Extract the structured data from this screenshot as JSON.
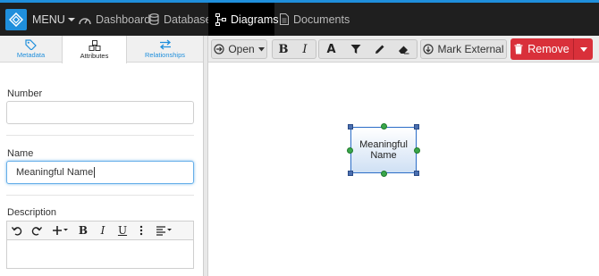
{
  "nav": {
    "menu_label": "MENU",
    "items": [
      {
        "label": "Dashboard",
        "icon": "dashboard-icon"
      },
      {
        "label": "Database",
        "icon": "database-icon"
      },
      {
        "label": "Diagrams",
        "icon": "diagram-icon",
        "active": true
      },
      {
        "label": "Documents",
        "icon": "document-icon"
      }
    ]
  },
  "tabs": [
    {
      "label": "Metadata",
      "icon": "tag-icon"
    },
    {
      "label": "Attributes",
      "icon": "cubes-icon",
      "active": true
    },
    {
      "label": "Relationships",
      "icon": "arrows-exchange-icon"
    }
  ],
  "form": {
    "number_label": "Number",
    "number_value": "",
    "name_label": "Name",
    "name_value": "Meaningful Name",
    "description_label": "Description",
    "editor_buttons": [
      "undo",
      "redo",
      "insert",
      "bold",
      "italic",
      "underline",
      "more",
      "align"
    ]
  },
  "toolbar": {
    "open_label": "Open",
    "mark_external_label": "Mark External",
    "remove_label": "Remove"
  },
  "canvas": {
    "node_label": "Meaningful Name"
  },
  "colors": {
    "accent": "#1f8fdc",
    "nav_bg": "#1f1f1f",
    "remove": "#d9303a",
    "node_border": "#2b6dc7"
  }
}
